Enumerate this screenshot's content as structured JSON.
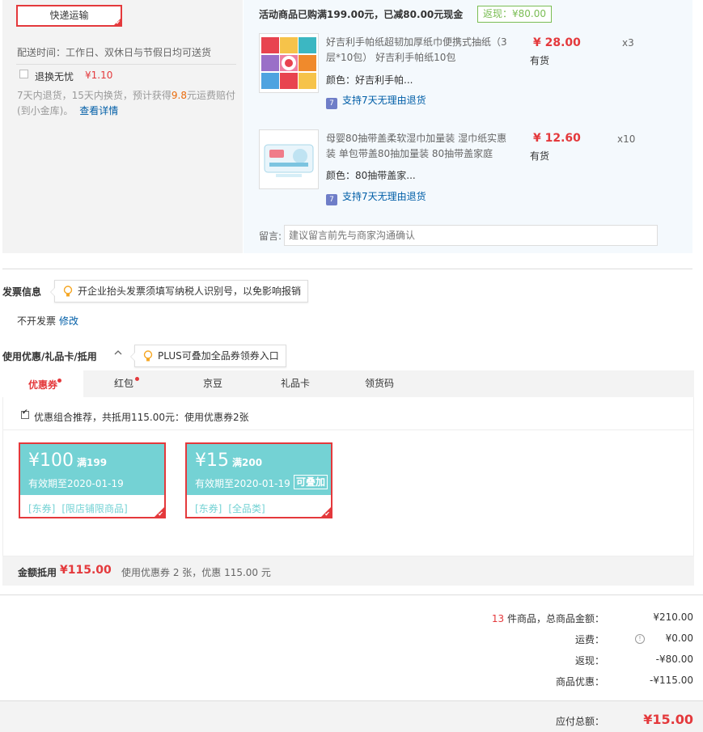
{
  "shipping": {
    "method_label": "快递运输",
    "delivery_time": "配送时间：工作日、双休日与节假日均可送货",
    "return_service_label": "退换无忧",
    "return_service_price": "¥1.10",
    "return_desc_prefix": "7天内退货，15天内换货，预计获得",
    "return_desc_amount": "9.8",
    "return_desc_suffix": "元运费赔付(到小金库)。",
    "return_details_link": "查看详情"
  },
  "promo": {
    "title": "活动商品已购满199.00元，已减80.00元现金",
    "badge": "返现：¥80.00"
  },
  "products": [
    {
      "name": "好吉利手帕纸超韧加厚纸巾便携式抽纸（3层*10包） 好吉利手帕纸10包",
      "price": "¥ 28.00",
      "stock": "有货",
      "qty": "x3",
      "color": "颜色：好吉利手帕...",
      "return_policy": "支持7天无理由退货"
    },
    {
      "name": "母婴80抽带盖柔软湿巾加量装 湿巾纸实惠装 单包带盖80抽加量装 80抽带盖家庭",
      "price": "¥ 12.60",
      "stock": "有货",
      "qty": "x10",
      "color": "颜色：80抽带盖家...",
      "return_policy": "支持7天无理由退货"
    }
  ],
  "message": {
    "label": "留言:",
    "placeholder": "建议留言前先与商家沟通确认"
  },
  "invoice": {
    "title": "发票信息",
    "tip": "开企业抬头发票须填写纳税人识别号，以免影响报销",
    "status": "不开发票",
    "edit_link": "修改"
  },
  "coupons": {
    "title": "使用优惠/礼品卡/抵用",
    "tip": "PLUS可叠加全品券领券入口",
    "tabs": [
      "优惠券",
      "红包",
      "京豆",
      "礼品卡",
      "领货码"
    ],
    "combo_text": "优惠组合推荐，共抵用115.00元：使用优惠券2张",
    "items": [
      {
        "amount": "¥100",
        "condition": "满199",
        "expiry": "有效期至2020-01-19",
        "stackable": "",
        "tag1": "[东券]",
        "tag2": "[限店铺限商品]"
      },
      {
        "amount": "¥15",
        "condition": "满200",
        "expiry": "有效期至2020-01-19",
        "stackable": "可叠加",
        "tag1": "[东券]",
        "tag2": "[全品类]"
      }
    ],
    "deduct_label": "金额抵用",
    "deduct_amount": "¥115.00",
    "deduct_desc": "使用优惠券 2 张，优惠 115.00 元"
  },
  "summary": {
    "count": "13",
    "count_label": "件商品，总商品金额：",
    "goods_total": "¥210.00",
    "shipping_label": "运费：",
    "shipping_value": "¥0.00",
    "cashback_label": "返现：",
    "cashback_value": "-¥80.00",
    "discount_label": "商品优惠：",
    "discount_value": "-¥115.00",
    "payable_label": "应付总额：",
    "payable_value": "¥15.00"
  },
  "colors": {
    "accent_red": "#e4393c",
    "link_blue": "#005ea7",
    "coupon_teal": "#74d2d4",
    "badge_green": "#7abd54"
  }
}
